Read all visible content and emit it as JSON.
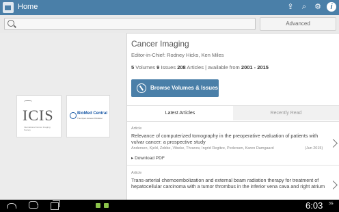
{
  "app": {
    "title": "Home",
    "icons": [
      "share-icon",
      "search-icon",
      "settings-icon",
      "info-icon"
    ]
  },
  "search": {
    "placeholder": "",
    "advanced_label": "Advanced"
  },
  "logos": {
    "icis": "ICIS",
    "icis_subtitle": "International Cancer Imaging Society",
    "bmc_name": "BioMed Central",
    "bmc_subtitle": "The Open Access Publisher"
  },
  "journal": {
    "title": "Cancer Imaging",
    "editor": "Editor-in-Chief: Rodney Hicks, Ken Miles",
    "volumes_count": "5",
    "volumes_label": "Volumes",
    "issues_count": "9",
    "issues_label": "Issues",
    "articles_count": "208",
    "articles_label": "Articles",
    "available_label": "available from",
    "available_range": "2001 - 2015",
    "browse_label": "Browse Volumes & Issues"
  },
  "tabs": [
    "Latest Articles",
    "Recently Read"
  ],
  "articles": [
    {
      "type": "Article",
      "title": "Relevance of computerized tomography in the preoperative evaluation of patients with vulvar cancer: a prospective study",
      "authors": "Andersen, Kjeld, Zobbe, Vibeke, Thranov, Ingrid Regitze, Pedersen, Karen Damgaard",
      "date": "(Jun 2015)",
      "download": "Download PDF"
    },
    {
      "type": "Article",
      "title": "Trans-arterial chemoembolization and external beam radiation therapy for treatment of hepatocellular carcinoma with a tumor thrombus in the inferior vena cava and right atrium"
    }
  ],
  "status": {
    "time": "6:03",
    "signal": "3G"
  }
}
